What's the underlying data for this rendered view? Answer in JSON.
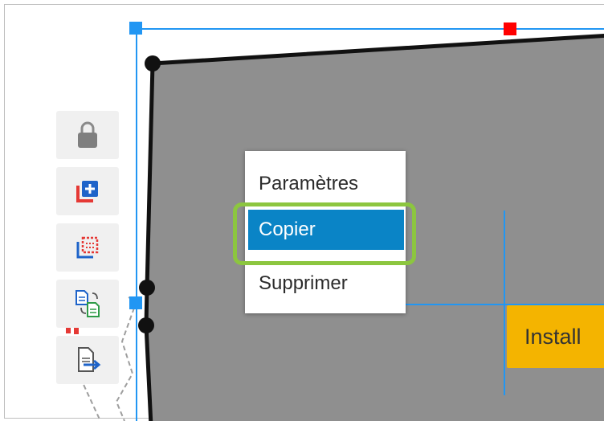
{
  "context_menu": {
    "items": [
      {
        "label": "Paramètres"
      },
      {
        "label": "Copier",
        "selected": true
      },
      {
        "label": "Supprimer"
      }
    ]
  },
  "toolbar": {
    "tools": [
      {
        "icon": "lock-icon"
      },
      {
        "icon": "add-copy-icon"
      },
      {
        "icon": "select-copy-icon"
      },
      {
        "icon": "swap-document-icon"
      },
      {
        "icon": "export-document-icon"
      }
    ]
  },
  "shape_label": "Install",
  "colors": {
    "shape_fill": "#8f8f8f",
    "selection": "#2196f3",
    "handle": "#2196f3",
    "rotation_handle": "#ff0000",
    "menu_active": "#0a84c6",
    "highlight": "#8cc63f",
    "tag": "#f4b400"
  }
}
